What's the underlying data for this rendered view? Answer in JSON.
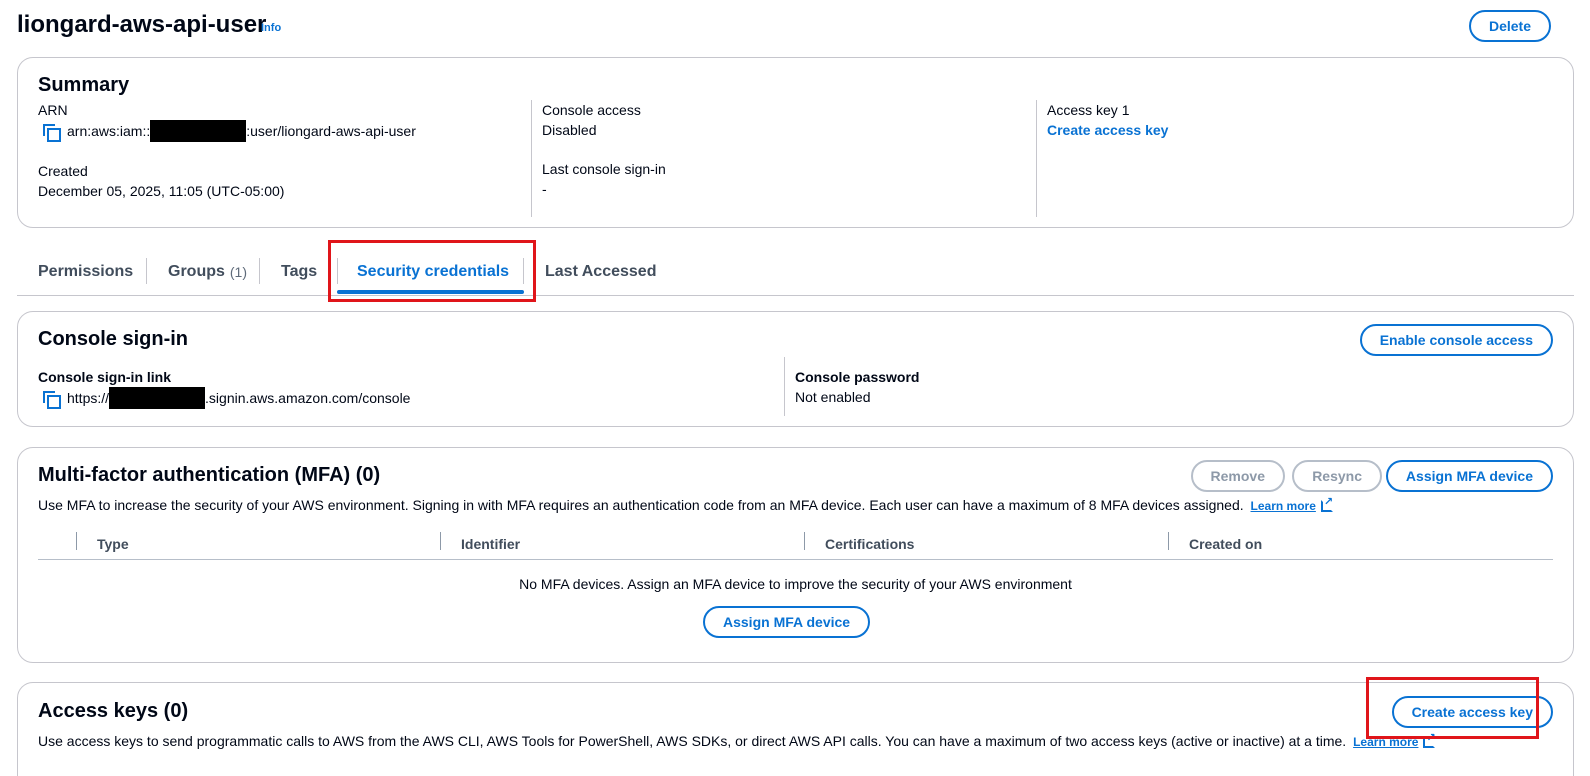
{
  "header": {
    "title": "liongard-aws-api-user",
    "info_link": "Info",
    "delete_label": "Delete"
  },
  "summary": {
    "title": "Summary",
    "arn_label": "ARN",
    "arn_prefix": "arn:aws:iam::",
    "arn_suffix": ":user/liongard-aws-api-user",
    "created_label": "Created",
    "created_value": "December 05, 2025, 11:05 (UTC-05:00)",
    "console_access_label": "Console access",
    "console_access_value": "Disabled",
    "last_signin_label": "Last console sign-in",
    "last_signin_value": "-",
    "access_key_label": "Access key 1",
    "access_key_link": "Create access key"
  },
  "tabs": [
    {
      "label": "Permissions"
    },
    {
      "label": "Groups",
      "count": "(1)"
    },
    {
      "label": "Tags"
    },
    {
      "label": "Security credentials",
      "active": true
    },
    {
      "label": "Last Accessed"
    }
  ],
  "console_signin": {
    "title": "Console sign-in",
    "enable_button": "Enable console access",
    "link_label": "Console sign-in link",
    "link_prefix": "https://",
    "link_suffix": ".signin.aws.amazon.com/console",
    "password_label": "Console password",
    "password_value": "Not enabled"
  },
  "mfa": {
    "title": "Multi-factor authentication (MFA) (0)",
    "remove_button": "Remove",
    "resync_button": "Resync",
    "assign_button": "Assign MFA device",
    "description": "Use MFA to increase the security of your AWS environment. Signing in with MFA requires an authentication code from an MFA device. Each user can have a maximum of 8 MFA devices assigned.",
    "learn_more": "Learn more",
    "columns": [
      "Type",
      "Identifier",
      "Certifications",
      "Created on"
    ],
    "empty_message": "No MFA devices. Assign an MFA device to improve the security of your AWS environment",
    "empty_button": "Assign MFA device"
  },
  "access_keys": {
    "title": "Access keys (0)",
    "create_button": "Create access key",
    "description": "Use access keys to send programmatic calls to AWS from the AWS CLI, AWS Tools for PowerShell, AWS SDKs, or direct AWS API calls. You can have a maximum of two access keys (active or inactive) at a time.",
    "learn_more": "Learn more"
  },
  "colors": {
    "accent": "#0972d3",
    "highlight": "#e0151a",
    "border": "#c6c6cd"
  }
}
